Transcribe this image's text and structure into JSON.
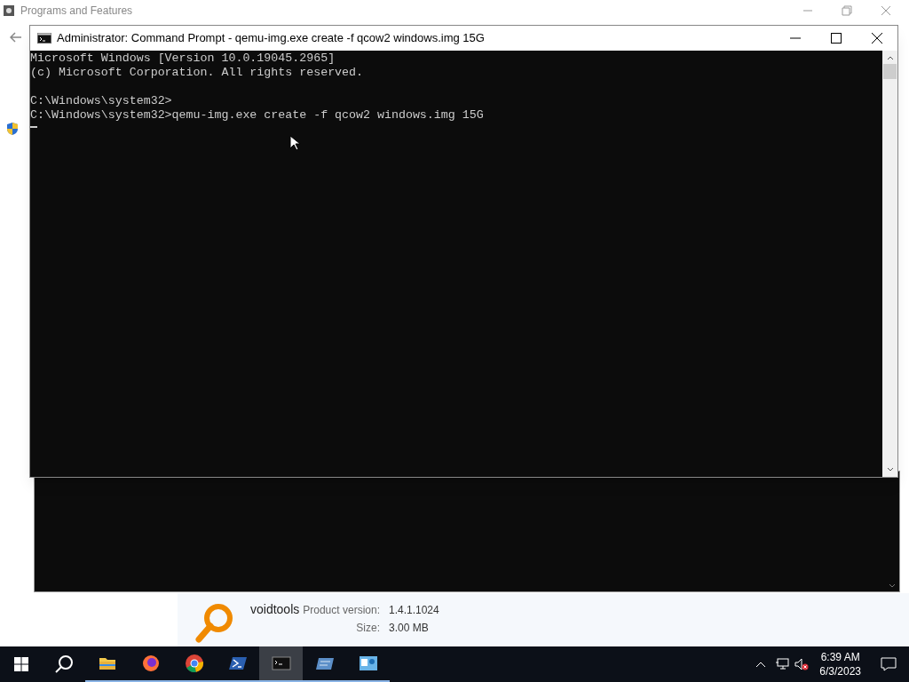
{
  "background_window": {
    "title": "Programs and Features",
    "details": {
      "publisher": "voidtools",
      "fields": [
        {
          "label": "Product version:",
          "value": "1.4.1.1024"
        },
        {
          "label": "Size:",
          "value": "3.00 MB"
        }
      ]
    }
  },
  "console_window": {
    "title": "Administrator:  Command Prompt - qemu-img.exe  create -f qcow2 windows.img 15G",
    "output_blocks": [
      [
        "Microsoft Windows [Version 10.0.19045.2965]",
        "(c) Microsoft Corporation. All rights reserved."
      ],
      [
        "C:\\Windows\\system32>",
        "C:\\Windows\\system32>qemu-img.exe create -f qcow2 windows.img 15G"
      ]
    ]
  },
  "taskbar": {
    "apps": [
      {
        "kind": "explorer",
        "selected": false
      },
      {
        "kind": "firefox",
        "selected": false
      },
      {
        "kind": "chrome",
        "selected": false
      },
      {
        "kind": "powershell",
        "selected": false
      },
      {
        "kind": "console",
        "selected": true
      },
      {
        "kind": "app",
        "selected": false
      },
      {
        "kind": "panel",
        "selected": false
      }
    ],
    "time": "6:39 AM",
    "date": "6/3/2023"
  }
}
